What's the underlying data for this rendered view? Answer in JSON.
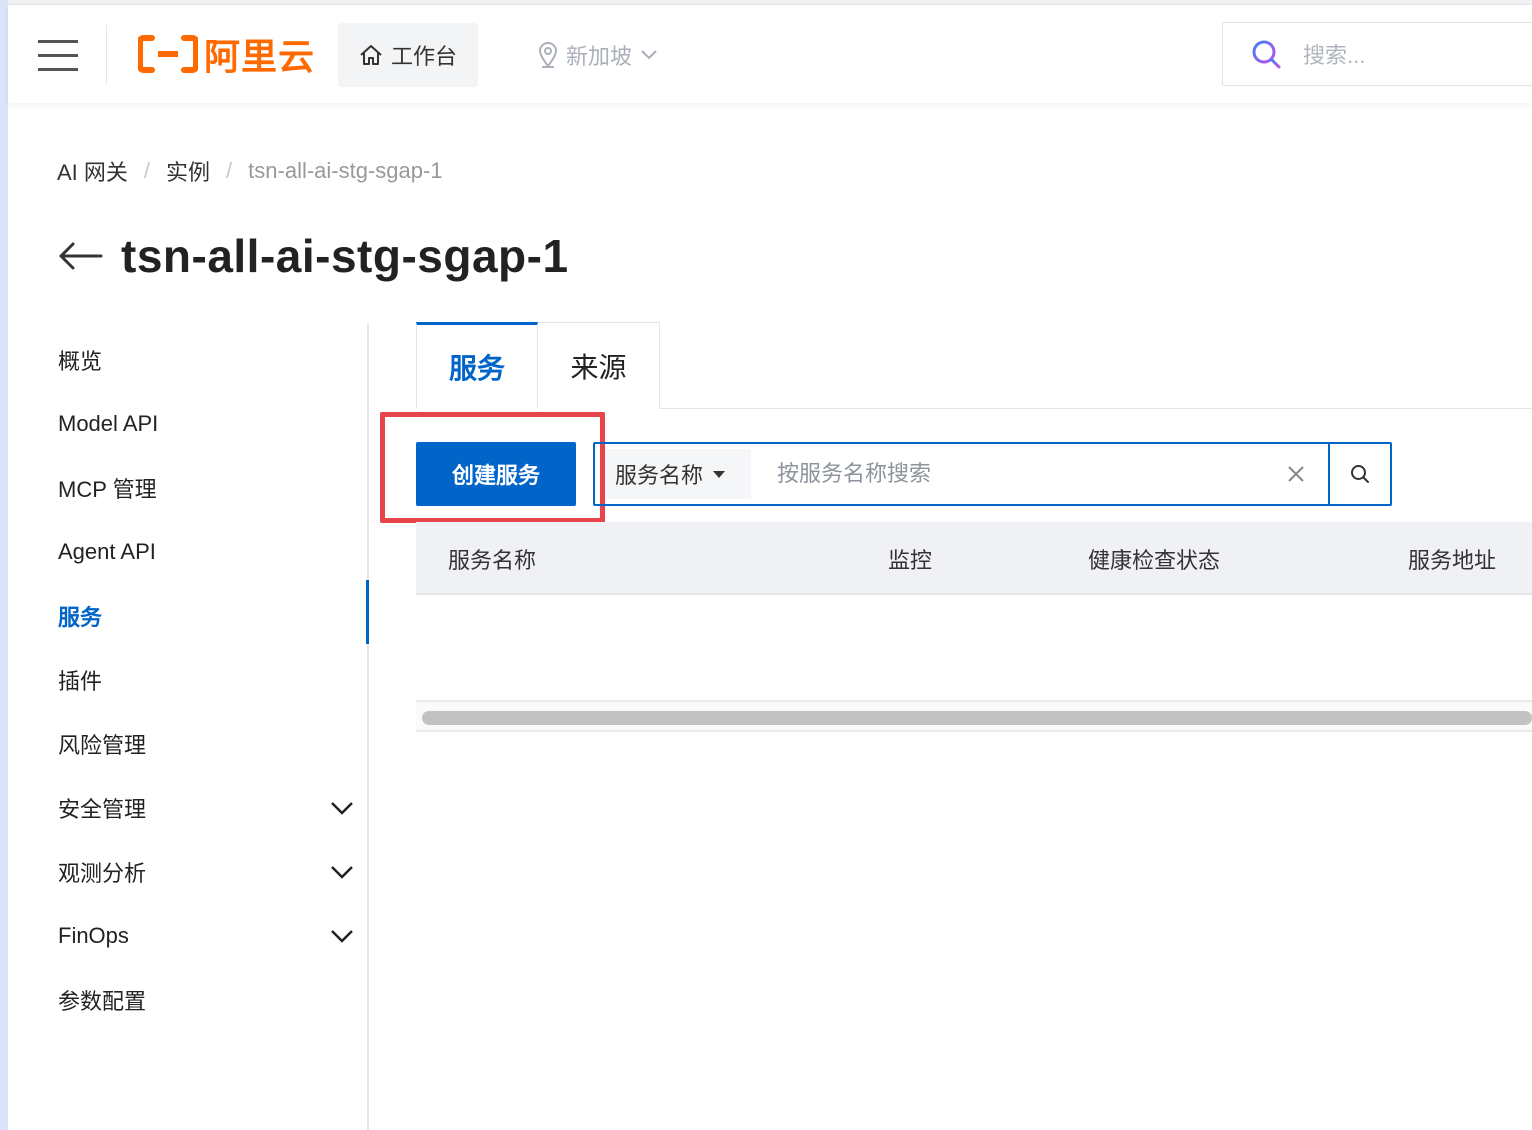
{
  "topbar": {
    "brand": "阿里云",
    "workbench_label": "工作台",
    "region_label": "新加坡",
    "search_placeholder": "搜索..."
  },
  "breadcrumb": [
    {
      "label": "AI 网关"
    },
    {
      "label": "实例"
    },
    {
      "label": "tsn-all-ai-stg-sgap-1"
    }
  ],
  "page": {
    "title": "tsn-all-ai-stg-sgap-1"
  },
  "sidebar": {
    "items": [
      {
        "label": "概览",
        "active": false,
        "expandable": false
      },
      {
        "label": "Model API",
        "active": false,
        "expandable": false
      },
      {
        "label": "MCP 管理",
        "active": false,
        "expandable": false
      },
      {
        "label": "Agent API",
        "active": false,
        "expandable": false
      },
      {
        "label": "服务",
        "active": true,
        "expandable": false
      },
      {
        "label": "插件",
        "active": false,
        "expandable": false
      },
      {
        "label": "风险管理",
        "active": false,
        "expandable": false
      },
      {
        "label": "安全管理",
        "active": false,
        "expandable": true
      },
      {
        "label": "观测分析",
        "active": false,
        "expandable": true
      },
      {
        "label": "FinOps",
        "active": false,
        "expandable": true
      },
      {
        "label": "参数配置",
        "active": false,
        "expandable": false
      }
    ]
  },
  "tabs": [
    {
      "label": "服务",
      "active": true
    },
    {
      "label": "来源",
      "active": false
    }
  ],
  "toolbar": {
    "create_label": "创建服务",
    "field_select_value": "服务名称",
    "search_placeholder": "按服务名称搜索"
  },
  "table": {
    "columns": [
      "服务名称",
      "监控",
      "健康检查状态",
      "服务地址"
    ],
    "rows": []
  },
  "colors": {
    "primary": "#0064c8",
    "brand": "#ff6a00",
    "highlight": "#e8444c"
  }
}
